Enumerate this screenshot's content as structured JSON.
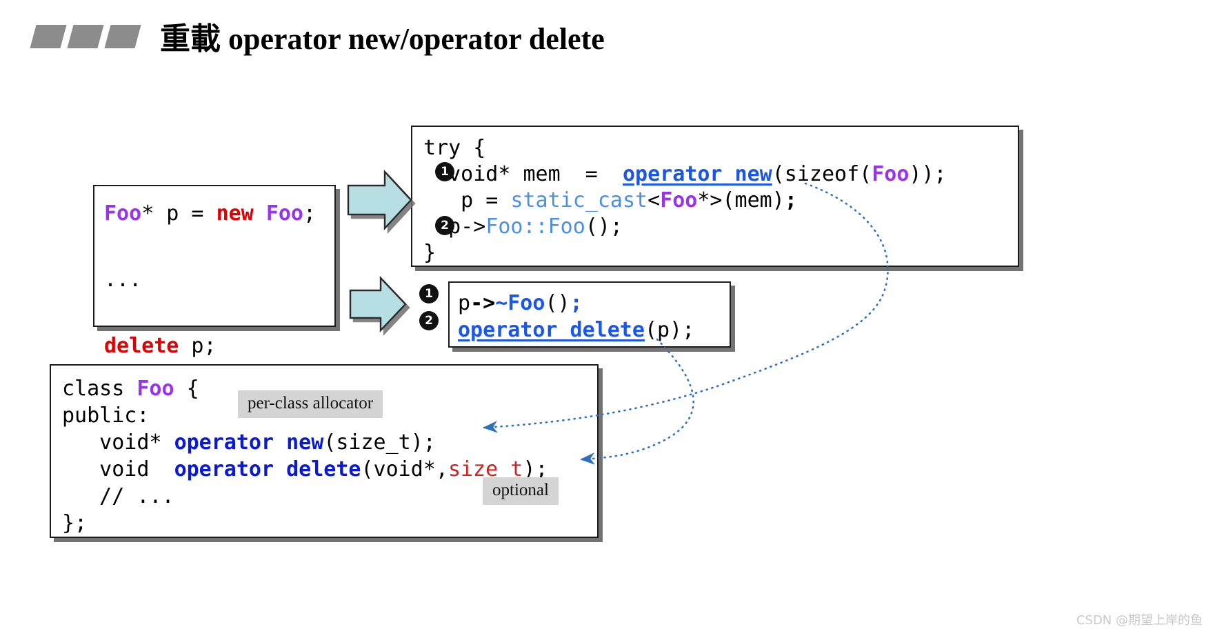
{
  "header": {
    "title_cjk": "重載",
    "title_latin": " operator new/operator delete",
    "bullet_icon": "parallelogram-bullets-icon"
  },
  "left_box": {
    "name": "client-code-box",
    "lines": [
      {
        "segments": [
          {
            "t": "Foo",
            "c": "kw-purple"
          },
          {
            "t": "* p = ",
            "c": "blk"
          },
          {
            "t": "new",
            "c": "kw-red"
          },
          {
            "t": " ",
            "c": "blk"
          },
          {
            "t": "Foo",
            "c": "kw-purple"
          },
          {
            "t": ";",
            "c": "blk"
          }
        ]
      },
      {
        "segments": [
          {
            "t": "",
            "c": "blk"
          }
        ]
      },
      {
        "segments": [
          {
            "t": "...",
            "c": "blk"
          }
        ]
      },
      {
        "segments": [
          {
            "t": "",
            "c": "blk"
          }
        ]
      },
      {
        "segments": [
          {
            "t": "delete",
            "c": "kw-red"
          },
          {
            "t": " p;",
            "c": "blk"
          }
        ]
      }
    ]
  },
  "try_box": {
    "name": "new-expansion-box",
    "lines": [
      {
        "segments": [
          {
            "t": "try {",
            "c": "blk"
          }
        ]
      },
      {
        "segments": [
          {
            "t": "  void* mem  =  ",
            "c": "blk"
          },
          {
            "t": "operator new",
            "c": "kw-blue-u"
          },
          {
            "t": "(sizeof(",
            "c": "blk"
          },
          {
            "t": "Foo",
            "c": "kw-purple"
          },
          {
            "t": "));",
            "c": "blk"
          }
        ]
      },
      {
        "segments": [
          {
            "t": "   p = ",
            "c": "blk"
          },
          {
            "t": "static_cast",
            "c": "kw-lightblue"
          },
          {
            "t": "<",
            "c": "blk"
          },
          {
            "t": "Foo",
            "c": "kw-purple"
          },
          {
            "t": "*>(mem)",
            "c": "blk"
          },
          {
            "t": ";",
            "c": "bold-blk"
          }
        ]
      },
      {
        "segments": [
          {
            "t": "  p->",
            "c": "blk"
          },
          {
            "t": "Foo::Foo",
            "c": "kw-lightblue"
          },
          {
            "t": "();",
            "c": "blk"
          }
        ]
      },
      {
        "segments": [
          {
            "t": "}",
            "c": "blk"
          }
        ]
      }
    ],
    "markers": [
      {
        "label": "1",
        "name": "step-marker-1"
      },
      {
        "label": "2",
        "name": "step-marker-2"
      }
    ]
  },
  "delete_box": {
    "name": "delete-expansion-box",
    "lines": [
      {
        "segments": [
          {
            "t": "p",
            "c": "blk"
          },
          {
            "t": "->",
            "c": "bold-blk"
          },
          {
            "t": "~Foo",
            "c": "kw-blue"
          },
          {
            "t": "()",
            "c": "blk"
          },
          {
            "t": ";",
            "c": "kw-blue"
          }
        ]
      },
      {
        "segments": [
          {
            "t": "operator delete",
            "c": "kw-blue-u"
          },
          {
            "t": "(p);",
            "c": "blk"
          }
        ]
      }
    ],
    "markers": [
      {
        "label": "1",
        "name": "step-marker-1"
      },
      {
        "label": "2",
        "name": "step-marker-2"
      }
    ]
  },
  "class_box": {
    "name": "class-definition-box",
    "lines": [
      {
        "segments": [
          {
            "t": "class ",
            "c": "blk"
          },
          {
            "t": "Foo",
            "c": "kw-purple"
          },
          {
            "t": " {",
            "c": "blk"
          }
        ]
      },
      {
        "segments": [
          {
            "t": "public:",
            "c": "blk"
          }
        ]
      },
      {
        "segments": [
          {
            "t": "   void* ",
            "c": "blk"
          },
          {
            "t": "operator new",
            "c": "kw-navy"
          },
          {
            "t": "(size_t);",
            "c": "blk"
          }
        ]
      },
      {
        "segments": [
          {
            "t": "   void  ",
            "c": "blk"
          },
          {
            "t": "operator delete",
            "c": "kw-navy"
          },
          {
            "t": "(void*,",
            "c": "blk"
          },
          {
            "t": "size_t",
            "c": "kw-darkred"
          },
          {
            "t": ");",
            "c": "blk"
          }
        ]
      },
      {
        "segments": [
          {
            "t": "   // ...",
            "c": "blk"
          }
        ]
      },
      {
        "segments": [
          {
            "t": "};",
            "c": "blk"
          }
        ]
      }
    ]
  },
  "callouts": [
    {
      "name": "per-class-allocator-callout",
      "text": "per-class allocator"
    },
    {
      "name": "optional-callout",
      "text": "optional"
    }
  ],
  "arrows": {
    "block_arrow_new": "block-arrow-right-icon",
    "block_arrow_delete": "block-arrow-right-icon",
    "connector_new": "dotted-connector-operator-new",
    "connector_delete": "dotted-connector-operator-delete"
  },
  "colors": {
    "bullet_grey": "#8c8c8c",
    "block_arrow_fill": "#b7dfe3",
    "connector_blue": "#2f6fc0",
    "purple": "#9933ee",
    "red": "#e00000",
    "blue": "#1a56e8",
    "navy": "#0a1ad0",
    "light_blue": "#4a90e2",
    "callout_bg": "#d4d4d4"
  },
  "watermark": {
    "text": "CSDN @期望上岸的鱼"
  }
}
